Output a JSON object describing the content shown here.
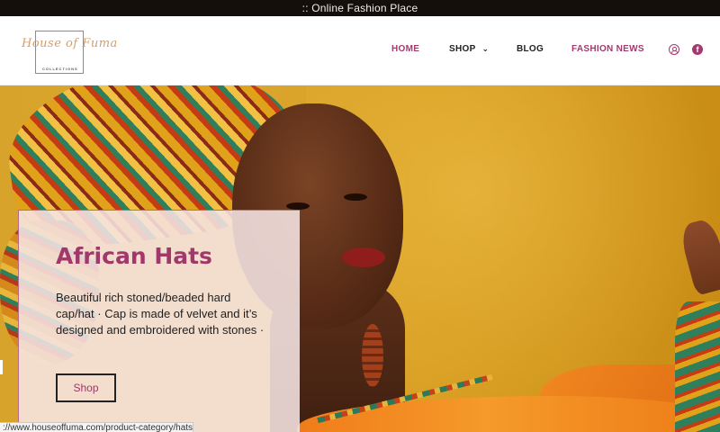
{
  "topbar": {
    "text": ":: Online Fashion Place"
  },
  "logo": {
    "script": "House of Fuma",
    "sub": "COLLECTIONS"
  },
  "nav": {
    "items": [
      {
        "label": "HOME"
      },
      {
        "label": "SHOP"
      },
      {
        "label": "BLOG"
      },
      {
        "label": "FASHION NEWS"
      }
    ],
    "icons": [
      "user-account-icon",
      "facebook-icon"
    ],
    "accent": "#a23a6f"
  },
  "hero": {
    "title": "African Hats",
    "description": "Beautiful rich stoned/beaded hard cap/hat · Cap is made of velvet and it’s designed and embroidered with stones ·",
    "button": "Shop"
  },
  "status": {
    "url": "://www.houseoffuma.com/product-category/hats/"
  },
  "colors": {
    "topbar": "#140f0b",
    "accent": "#a0386a",
    "hero_bg": "#d8a32a"
  }
}
